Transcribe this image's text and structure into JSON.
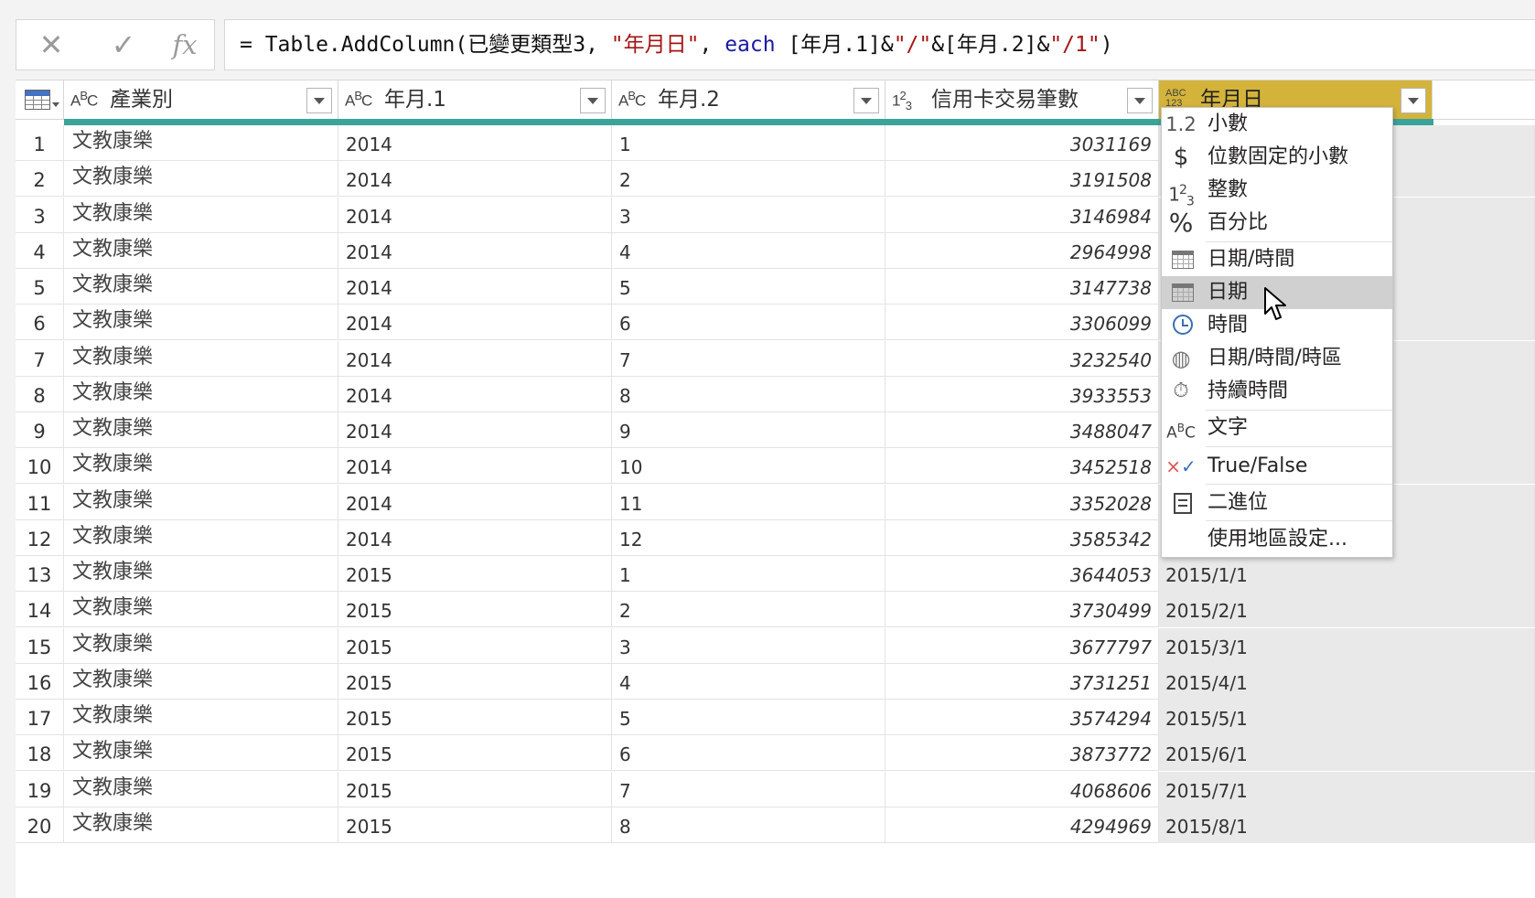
{
  "formula_bar": {
    "cancel_glyph": "✕",
    "commit_glyph": "✓",
    "fx_label": "fx",
    "formula_prefix": "= Table.AddColumn(已變更類型3, ",
    "formula_str1": "\"年月日\"",
    "formula_mid": ", ",
    "formula_kw": "each",
    "formula_p1": " [年月.1]&",
    "formula_str2": "\"/\"",
    "formula_p2": "&[年月.2]&",
    "formula_str3": "\"/1\"",
    "formula_end": ")"
  },
  "columns": [
    {
      "type_icon": "text-type-icon",
      "type_glyph": "ABC",
      "label": "產業別"
    },
    {
      "type_icon": "text-type-icon",
      "type_glyph": "ABC",
      "label": "年月.1"
    },
    {
      "type_icon": "text-type-icon",
      "type_glyph": "ABC",
      "label": "年月.2"
    },
    {
      "type_icon": "whole-number-type-icon",
      "type_glyph": "123",
      "label": "信用卡交易筆數"
    },
    {
      "type_icon": "any-type-icon",
      "type_glyph": "ABC123",
      "label": "年月日"
    }
  ],
  "rows": [
    {
      "n": "1",
      "ind": "文教康樂",
      "y": "2014",
      "m": "1",
      "cnt": "3031169",
      "date": ""
    },
    {
      "n": "2",
      "ind": "文教康樂",
      "y": "2014",
      "m": "2",
      "cnt": "3191508",
      "date": ""
    },
    {
      "n": "3",
      "ind": "文教康樂",
      "y": "2014",
      "m": "3",
      "cnt": "3146984",
      "date": ""
    },
    {
      "n": "4",
      "ind": "文教康樂",
      "y": "2014",
      "m": "4",
      "cnt": "2964998",
      "date": ""
    },
    {
      "n": "5",
      "ind": "文教康樂",
      "y": "2014",
      "m": "5",
      "cnt": "3147738",
      "date": ""
    },
    {
      "n": "6",
      "ind": "文教康樂",
      "y": "2014",
      "m": "6",
      "cnt": "3306099",
      "date": ""
    },
    {
      "n": "7",
      "ind": "文教康樂",
      "y": "2014",
      "m": "7",
      "cnt": "3232540",
      "date": ""
    },
    {
      "n": "8",
      "ind": "文教康樂",
      "y": "2014",
      "m": "8",
      "cnt": "3933553",
      "date": ""
    },
    {
      "n": "9",
      "ind": "文教康樂",
      "y": "2014",
      "m": "9",
      "cnt": "3488047",
      "date": ""
    },
    {
      "n": "10",
      "ind": "文教康樂",
      "y": "2014",
      "m": "10",
      "cnt": "3452518",
      "date": ""
    },
    {
      "n": "11",
      "ind": "文教康樂",
      "y": "2014",
      "m": "11",
      "cnt": "3352028",
      "date": ""
    },
    {
      "n": "12",
      "ind": "文教康樂",
      "y": "2014",
      "m": "12",
      "cnt": "3585342",
      "date": ""
    },
    {
      "n": "13",
      "ind": "文教康樂",
      "y": "2015",
      "m": "1",
      "cnt": "3644053",
      "date": "2015/1/1"
    },
    {
      "n": "14",
      "ind": "文教康樂",
      "y": "2015",
      "m": "2",
      "cnt": "3730499",
      "date": "2015/2/1"
    },
    {
      "n": "15",
      "ind": "文教康樂",
      "y": "2015",
      "m": "3",
      "cnt": "3677797",
      "date": "2015/3/1"
    },
    {
      "n": "16",
      "ind": "文教康樂",
      "y": "2015",
      "m": "4",
      "cnt": "3731251",
      "date": "2015/4/1"
    },
    {
      "n": "17",
      "ind": "文教康樂",
      "y": "2015",
      "m": "5",
      "cnt": "3574294",
      "date": "2015/5/1"
    },
    {
      "n": "18",
      "ind": "文教康樂",
      "y": "2015",
      "m": "6",
      "cnt": "3873772",
      "date": "2015/6/1"
    },
    {
      "n": "19",
      "ind": "文教康樂",
      "y": "2015",
      "m": "7",
      "cnt": "4068606",
      "date": "2015/7/1"
    },
    {
      "n": "20",
      "ind": "文教康樂",
      "y": "2015",
      "m": "8",
      "cnt": "4294969",
      "date": "2015/8/1"
    }
  ],
  "type_menu": {
    "items": [
      {
        "icon": "decimal-number-icon",
        "glyph": "1.2",
        "label": "小數"
      },
      {
        "icon": "fixed-decimal-icon",
        "glyph": "$",
        "label": "位數固定的小數"
      },
      {
        "icon": "whole-number-icon",
        "glyph": "123",
        "label": "整數"
      },
      {
        "icon": "percentage-icon",
        "glyph": "%",
        "label": "百分比"
      },
      {
        "icon": "datetime-icon",
        "glyph": "",
        "label": "日期/時間"
      },
      {
        "icon": "date-icon",
        "glyph": "",
        "label": "日期"
      },
      {
        "icon": "time-icon",
        "glyph": "",
        "label": "時間"
      },
      {
        "icon": "datetime-timezone-icon",
        "glyph": "",
        "label": "日期/時間/時區"
      },
      {
        "icon": "duration-icon",
        "glyph": "⏱",
        "label": "持續時間"
      },
      {
        "icon": "text-icon",
        "glyph": "ABC",
        "label": "文字"
      },
      {
        "icon": "true-false-icon",
        "glyph": "×✓",
        "label": "True/False"
      },
      {
        "icon": "binary-icon",
        "glyph": "",
        "label": "二進位"
      },
      {
        "icon": "",
        "glyph": "",
        "label": "使用地區設定..."
      }
    ],
    "highlighted": "日期"
  },
  "colors": {
    "selected_header": "#d4b33a",
    "quality_bar": "#3aa39a",
    "menu_highlight": "#d0d0d0"
  }
}
